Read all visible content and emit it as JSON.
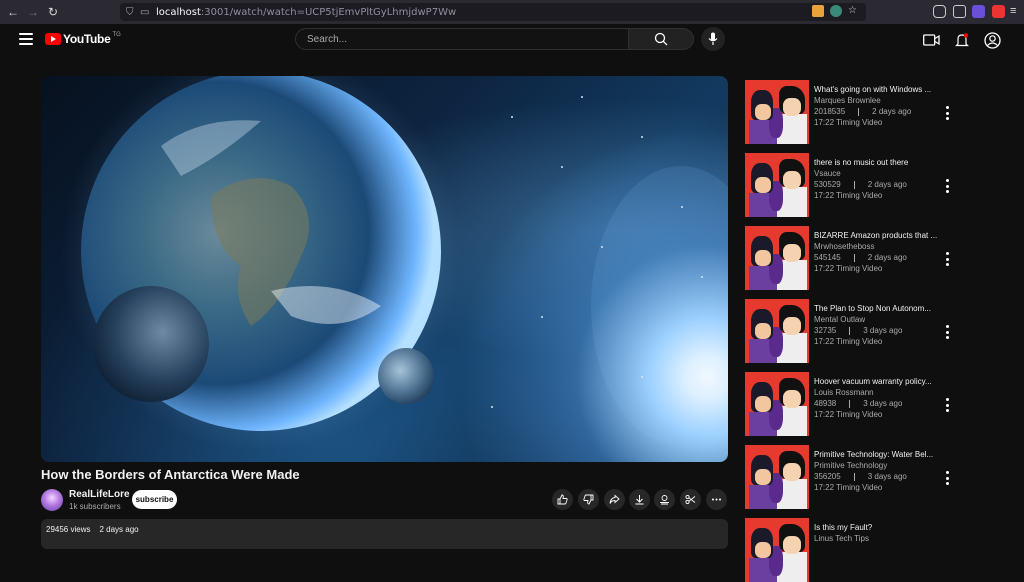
{
  "browser": {
    "url_host": "localhost",
    "url_path": ":3001/watch/watch=UCP5tjEmvPltGyLhmjdwP7Ww"
  },
  "header": {
    "logo_text": "YouTube",
    "logo_sup": "TG",
    "search_placeholder": "Search..."
  },
  "video": {
    "title": "How the Borders of Antarctica Were Made",
    "channel": "RealLifeLore",
    "subscribers": "1k subscribers",
    "subscribe_label": "subscribe",
    "views": "29456 views",
    "date": "2 days ago"
  },
  "actions": [
    "like-icon",
    "dislike-icon",
    "share-icon",
    "download-icon",
    "thanks-icon",
    "clip-icon",
    "more-icon"
  ],
  "recommendations": [
    {
      "title": "What's going on with Windows ...",
      "channel": "Marques Brownlee",
      "views": "2018535",
      "date": "2 days ago",
      "type": "17:22 Timing Video"
    },
    {
      "title": "there is no music out there",
      "channel": "Vsauce",
      "views": "530529",
      "date": "2 days ago",
      "type": "17:22 Timing Video"
    },
    {
      "title": "BIZARRE Amazon products that ...",
      "channel": "Mrwhosetheboss",
      "views": "545145",
      "date": "2 days ago",
      "type": "17:22 Timing Video"
    },
    {
      "title": "The Plan to Stop Non Autonom...",
      "channel": "Mental Outlaw",
      "views": "32735",
      "date": "3 days ago",
      "type": "17:22 Timing Video"
    },
    {
      "title": "Hoover vacuum warranty policy...",
      "channel": "Louis Rossmann",
      "views": "48938",
      "date": "3 days ago",
      "type": "17:22 Timing Video"
    },
    {
      "title": "Primitive Technology: Water Bel...",
      "channel": "Primitive Technology",
      "views": "356205",
      "date": "3 days ago",
      "type": "17:22 Timing Video"
    },
    {
      "title": "Is this my Fault?",
      "channel": "Linus Tech Tips",
      "views": "",
      "date": "",
      "type": ""
    }
  ]
}
